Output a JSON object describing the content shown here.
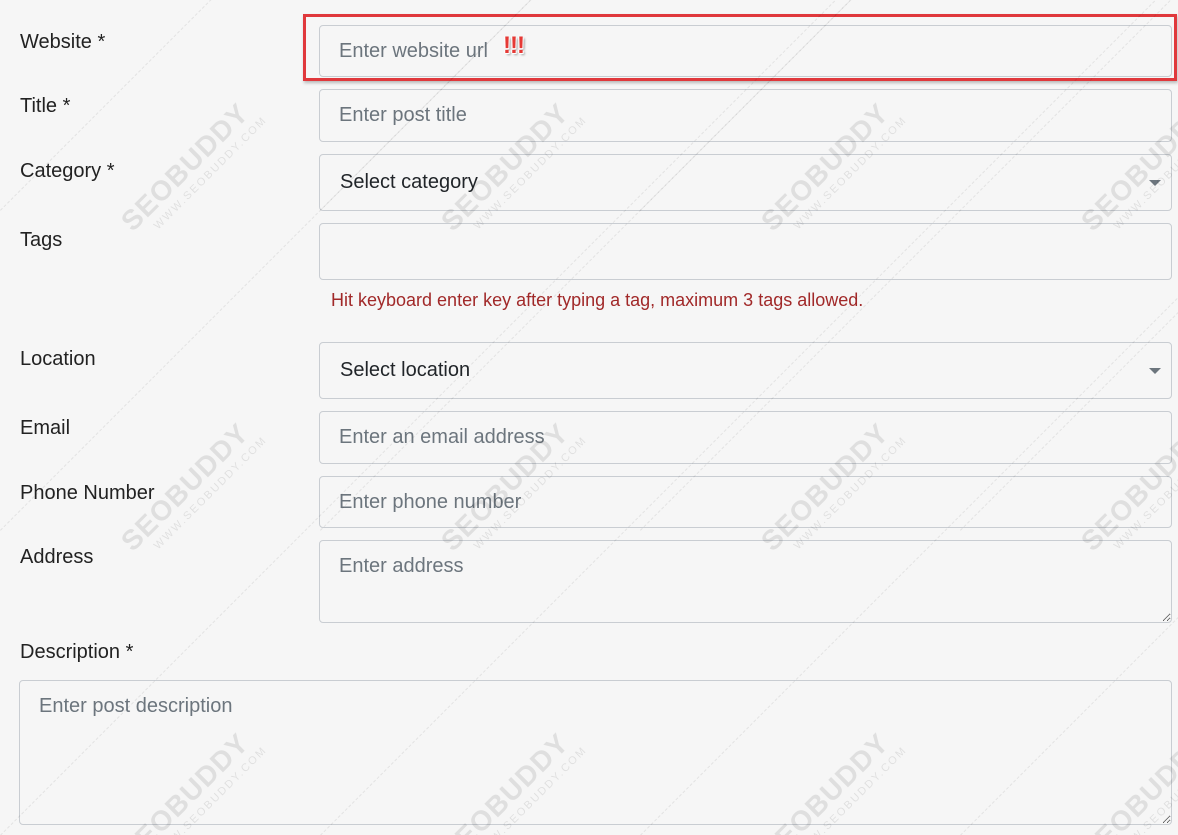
{
  "form": {
    "website": {
      "label": "Website *",
      "placeholder": "Enter website url"
    },
    "title": {
      "label": "Title *",
      "placeholder": "Enter post title"
    },
    "category": {
      "label": "Category *",
      "selected": "Select category"
    },
    "tags": {
      "label": "Tags",
      "value": "",
      "hint": "Hit keyboard enter key after typing a tag, maximum 3 tags allowed."
    },
    "location": {
      "label": "Location",
      "selected": "Select location"
    },
    "email": {
      "label": "Email",
      "placeholder": "Enter an email address"
    },
    "phone": {
      "label": "Phone Number",
      "placeholder": "Enter phone number"
    },
    "address": {
      "label": "Address",
      "placeholder": "Enter address"
    },
    "description": {
      "label": "Description *",
      "placeholder": "Enter post description"
    }
  },
  "annotation": {
    "marker": "!!!",
    "highlight_color": "#e0383c"
  },
  "watermark": {
    "brand": "SEOBUDDY",
    "url": "WWW.SEOBUDDY.COM"
  }
}
